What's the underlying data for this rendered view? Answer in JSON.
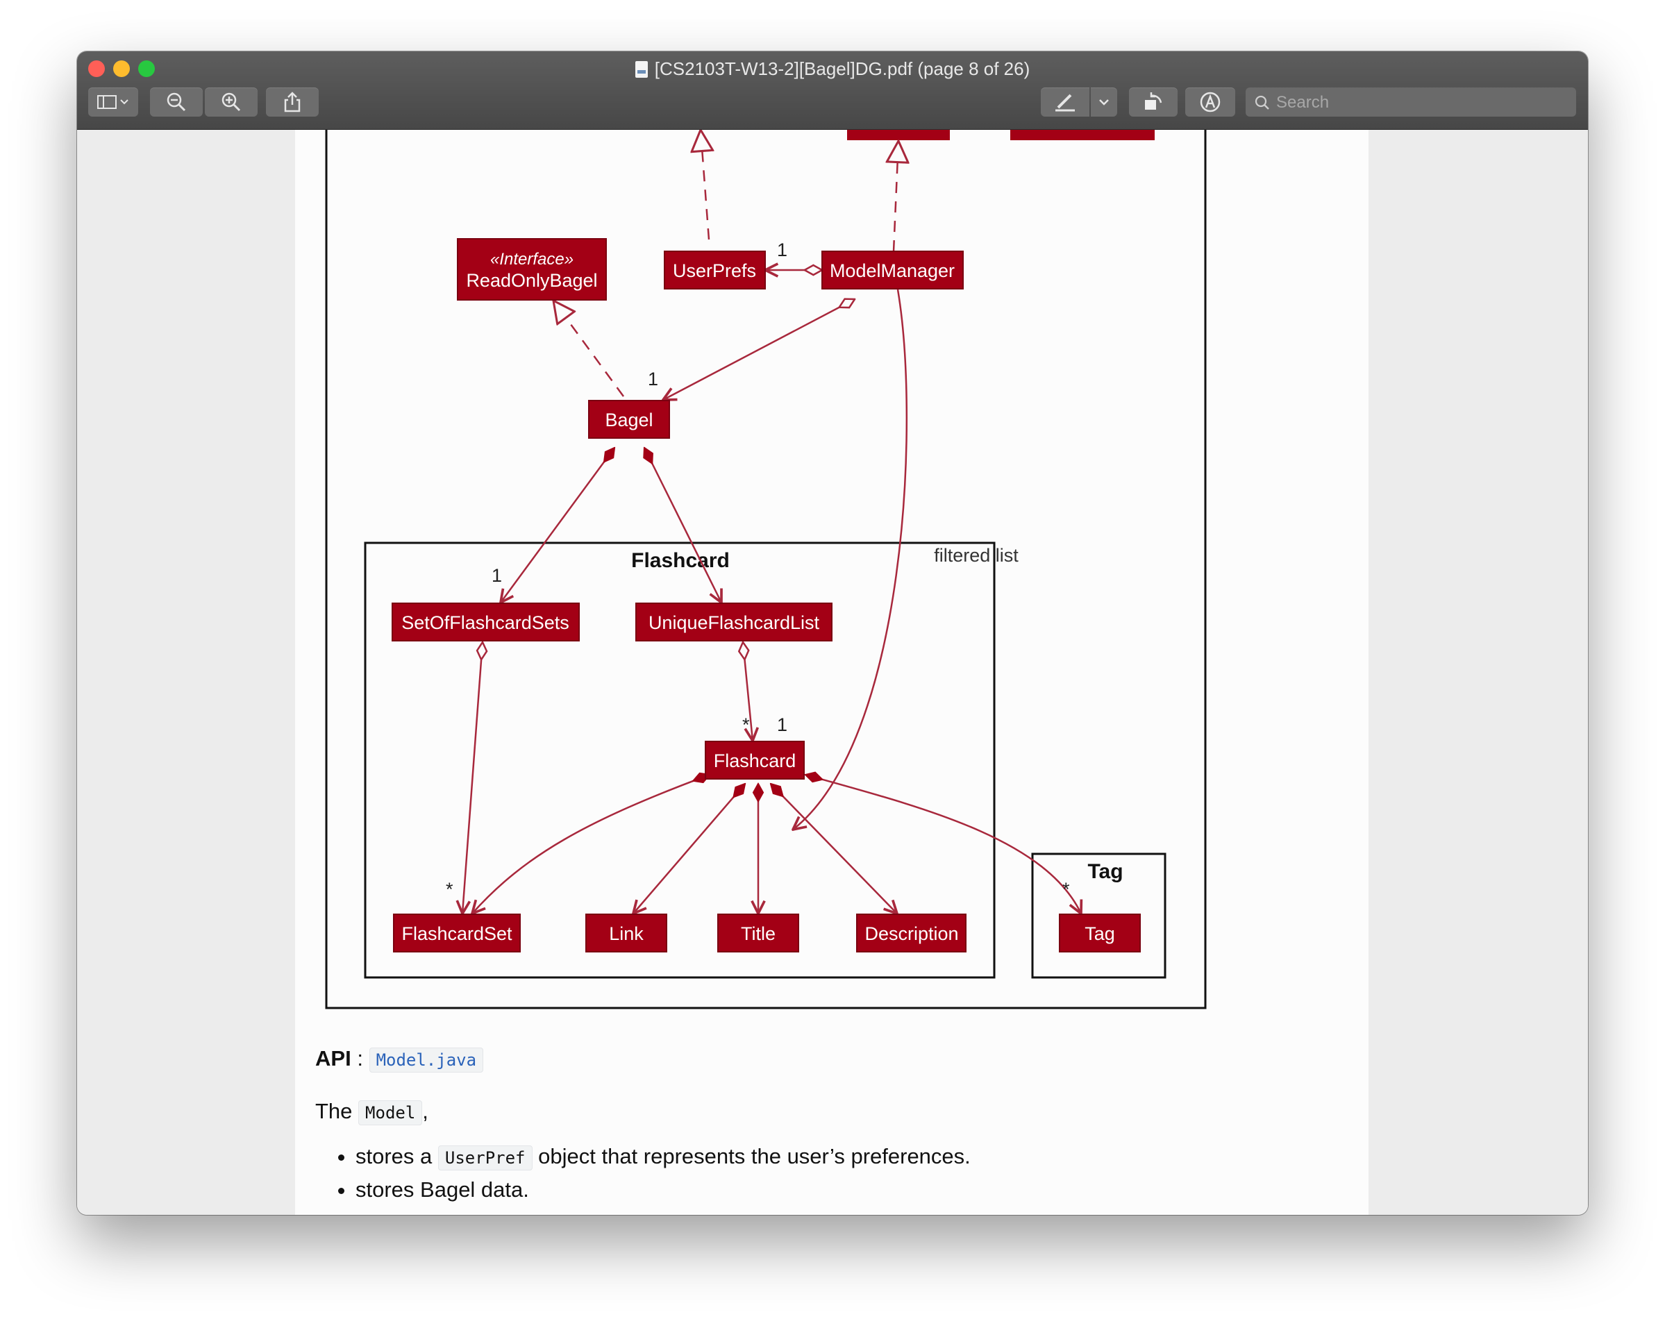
{
  "window": {
    "title": "[CS2103T-W13-2][Bagel]DG.pdf (page 8 of 26)"
  },
  "toolbar": {
    "search_placeholder": "Search"
  },
  "diagram": {
    "classes": {
      "read_only_stereotype": "«Interface»",
      "read_only_bagel": "ReadOnlyBagel",
      "user_prefs": "UserPrefs",
      "model_manager": "ModelManager",
      "bagel": "Bagel",
      "set_of_flashcard_sets": "SetOfFlashcardSets",
      "unique_flashcard_list": "UniqueFlashcardList",
      "flashcard": "Flashcard",
      "flashcard_set": "FlashcardSet",
      "link": "Link",
      "title": "Title",
      "description": "Description",
      "tag": "Tag"
    },
    "packages": {
      "flashcard": "Flashcard",
      "tag": "Tag"
    },
    "labels": {
      "filtered_list": "filtered list",
      "mult_userprefs": "1",
      "mult_bagel": "1",
      "mult_set_of_sets": "1",
      "mult_flashcard_star": "*",
      "mult_flashcard_one": "1",
      "mult_flashcardset": "*",
      "mult_tag": "*"
    }
  },
  "text": {
    "api_label": "API",
    "api_sep": ":",
    "api_link": "Model.java",
    "model_prefix": "The",
    "model_code": "Model",
    "model_suffix": ",",
    "bullet1_prefix": "stores a",
    "bullet1_code": "UserPref",
    "bullet1_suffix": "object that represents the user’s preferences.",
    "bullet2": "stores Bagel data."
  },
  "colors": {
    "class_fill": "#a30015",
    "arrow": "#a8283c"
  }
}
